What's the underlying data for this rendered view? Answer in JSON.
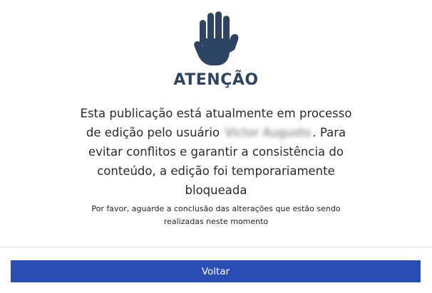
{
  "dialog": {
    "icon": "raised-hand-icon",
    "title": "ATENÇÃO",
    "message_before": "Esta publicação está atualmente em processo de edição pelo usuário",
    "username": "Victor Augusto",
    "message_after": ". Para evitar conflitos e garantir a consistência do conteúdo, a edição foi temporariamente bloqueada",
    "note": "Por favor, aguarde a conclusão das alterações que estão sendo realizadas neste momento",
    "back_label": "Voltar"
  },
  "colors": {
    "title": "#2d4562",
    "icon": "#2d4562",
    "button": "#2a4db3"
  }
}
